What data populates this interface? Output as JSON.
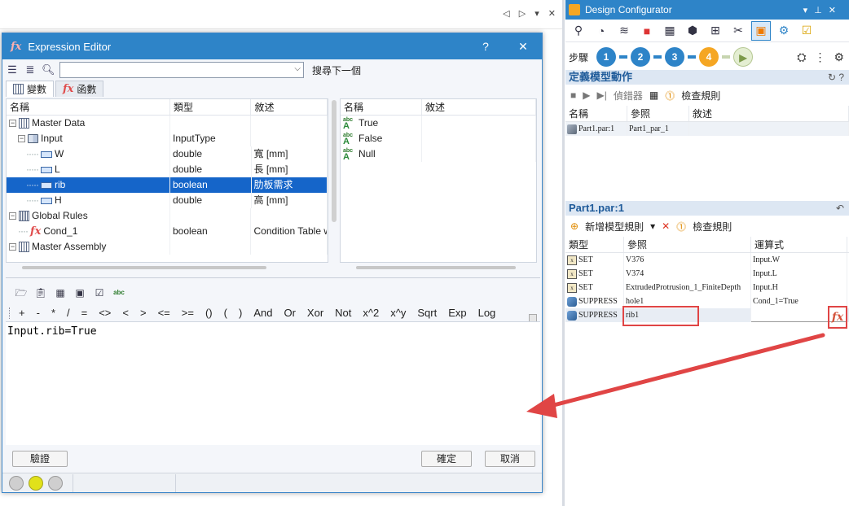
{
  "host": {
    "nav_glyphs": "◁ ▷ ▾ ✕"
  },
  "expression_editor": {
    "title": "Expression Editor",
    "title_help": "?",
    "title_close": "✕",
    "search_placeholder": "",
    "search_next": "搜尋下一個",
    "tabs": {
      "variables": "變數",
      "functions": "函數"
    },
    "columns": {
      "name": "名稱",
      "type": "類型",
      "desc": "敘述"
    },
    "rows": [
      {
        "name": "Master Data",
        "type": "",
        "desc": ""
      },
      {
        "name": "Input",
        "type": "InputType",
        "desc": ""
      },
      {
        "name": "W",
        "type": "double",
        "desc": "寬 [mm]"
      },
      {
        "name": "L",
        "type": "double",
        "desc": "長 [mm]"
      },
      {
        "name": "rib",
        "type": "boolean",
        "desc": "肋板需求"
      },
      {
        "name": "H",
        "type": "double",
        "desc": "高 [mm]"
      },
      {
        "name": "Global Rules",
        "type": "",
        "desc": ""
      },
      {
        "name": "Cond_1",
        "type": "boolean",
        "desc": "Condition Table w"
      },
      {
        "name": "Master Assembly",
        "type": "",
        "desc": ""
      }
    ],
    "right_columns": {
      "name": "名稱",
      "desc": "敘述"
    },
    "right_rows": [
      "True",
      "False",
      "Null"
    ],
    "operators": [
      "+",
      "-",
      "*",
      "/",
      "=",
      "<>",
      "<",
      ">",
      "<=",
      ">=",
      "()",
      "(",
      ")",
      "And",
      "Or",
      "Xor",
      "Not",
      "x^2",
      "x^y",
      "Sqrt",
      "Exp",
      "Log"
    ],
    "expression": "Input.rib=True",
    "btn_validate": "驗證",
    "btn_ok": "確定",
    "btn_cancel": "取消"
  },
  "design_configurator": {
    "title": "Design Configurator",
    "steps_label": "步驟",
    "steps": [
      "1",
      "2",
      "3",
      "4"
    ],
    "section1": "定義模型動作",
    "toolbar1": {
      "debugger": "偵錯器",
      "check": "檢查規則"
    },
    "table1_cols": {
      "name": "名稱",
      "ref": "參照",
      "desc": "敘述"
    },
    "table1_rows": [
      {
        "name": "Part1.par:1",
        "ref": "Part1_par_1",
        "desc": ""
      }
    ],
    "section2": "Part1.par:1",
    "toolbar2": {
      "add_rule": "新增模型規則",
      "check": "檢查規則"
    },
    "table2_cols": {
      "type": "類型",
      "ref": "參照",
      "expr": "運算式"
    },
    "table2_rows": [
      {
        "type": "SET",
        "ref": "V376",
        "expr": "Input.W"
      },
      {
        "type": "SET",
        "ref": "V374",
        "expr": "Input.L"
      },
      {
        "type": "SET",
        "ref": "ExtrudedProtrusion_1_FiniteDepth",
        "expr": "Input.H"
      },
      {
        "type": "SUPPRESS",
        "ref": "hole1",
        "expr": "Cond_1=True"
      },
      {
        "type": "SUPPRESS",
        "ref": "rib1",
        "expr": ""
      }
    ],
    "fx_button": "fx"
  },
  "colors": {
    "accent": "#2e84c8",
    "selection": "#1565c9",
    "highlight_red": "#e04545",
    "active_step": "#f5a623"
  }
}
